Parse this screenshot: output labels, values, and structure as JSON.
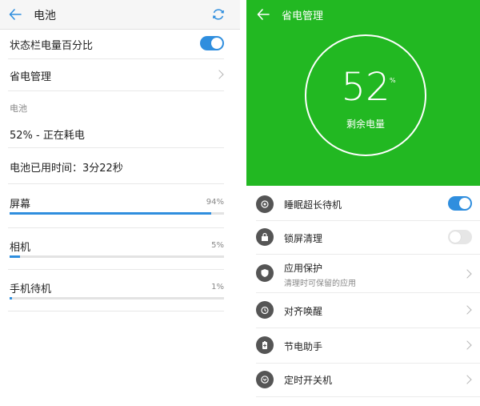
{
  "left": {
    "header": {
      "title": "电池"
    },
    "status_bar_percent": {
      "label": "状态栏电量百分比",
      "enabled": true
    },
    "power_saving": {
      "label": "省电管理"
    },
    "section_label": "电池",
    "status": "52% - 正在耗电",
    "usage_time": "电池已用时间：3分22秒",
    "usage": [
      {
        "name": "屏幕",
        "percent": "94%",
        "fraction": 0.94
      },
      {
        "name": "相机",
        "percent": "5%",
        "fraction": 0.05
      },
      {
        "name": "手机待机",
        "percent": "1%",
        "fraction": 0.01
      }
    ]
  },
  "right": {
    "header": {
      "title": "省电管理"
    },
    "gauge": {
      "value": "52",
      "unit": "%",
      "label": "剩余电量"
    },
    "items": [
      {
        "label": "睡眠超长待机",
        "control": "toggle",
        "enabled": true,
        "icon": "power-icon"
      },
      {
        "label": "锁屏清理",
        "control": "toggle",
        "enabled": false,
        "icon": "lock-clean-icon"
      },
      {
        "label": "应用保护",
        "sublabel": "清理时可保留的应用",
        "control": "chevron",
        "icon": "shield-icon"
      },
      {
        "label": "对齐唤醒",
        "control": "chevron",
        "icon": "alarm-clock-icon"
      },
      {
        "label": "节电助手",
        "control": "chevron",
        "icon": "battery-plus-icon"
      },
      {
        "label": "定时开关机",
        "control": "chevron",
        "icon": "timer-icon"
      }
    ]
  },
  "colors": {
    "accent_blue": "#2f8ede",
    "green": "#22b822"
  }
}
